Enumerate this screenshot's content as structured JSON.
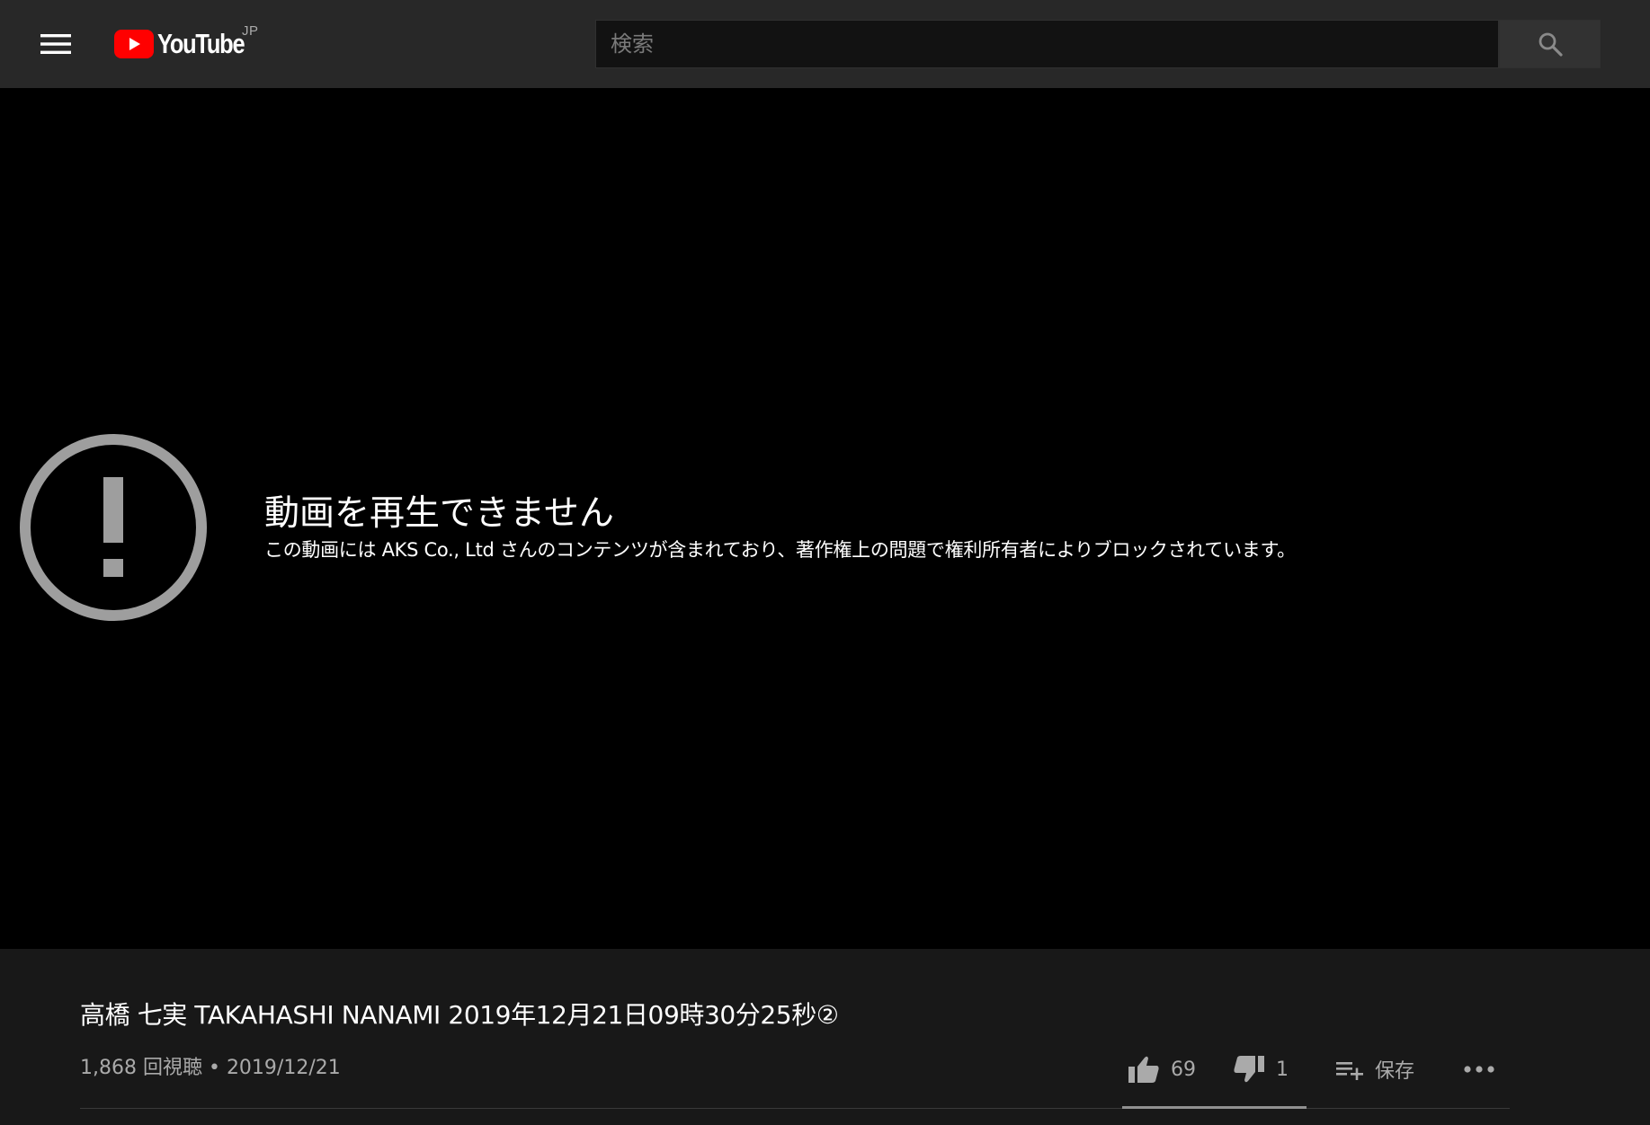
{
  "masthead": {
    "menu_icon": "hamburger-menu-icon",
    "logo": {
      "wordmark": "YouTube",
      "region": "JP",
      "brand_color": "#ff0000"
    },
    "search": {
      "placeholder": "検索",
      "value": "",
      "button_icon": "search-icon"
    }
  },
  "player": {
    "error_icon": "exclamation-circle-icon",
    "error_title": "動画を再生できません",
    "error_message": "この動画には AKS Co., Ltd さんのコンテンツが含まれており、著作権上の問題で権利所有者によりブロックされています。"
  },
  "video": {
    "title": "高橋 七実 TAKAHASHI NANAMI 2019年12月21日09時30分25秒②",
    "meta": "1,868 回視聴 • 2019/12/21",
    "actions": {
      "like_count": "69",
      "dislike_count": "1",
      "save_label": "保存",
      "more_icon": "more-horizontal-icon"
    },
    "like_ratio": 0.986
  },
  "colors": {
    "masthead_bg": "#282828",
    "page_bg": "#181818",
    "player_bg": "#000000",
    "secondary_text": "#aaaaaa"
  }
}
